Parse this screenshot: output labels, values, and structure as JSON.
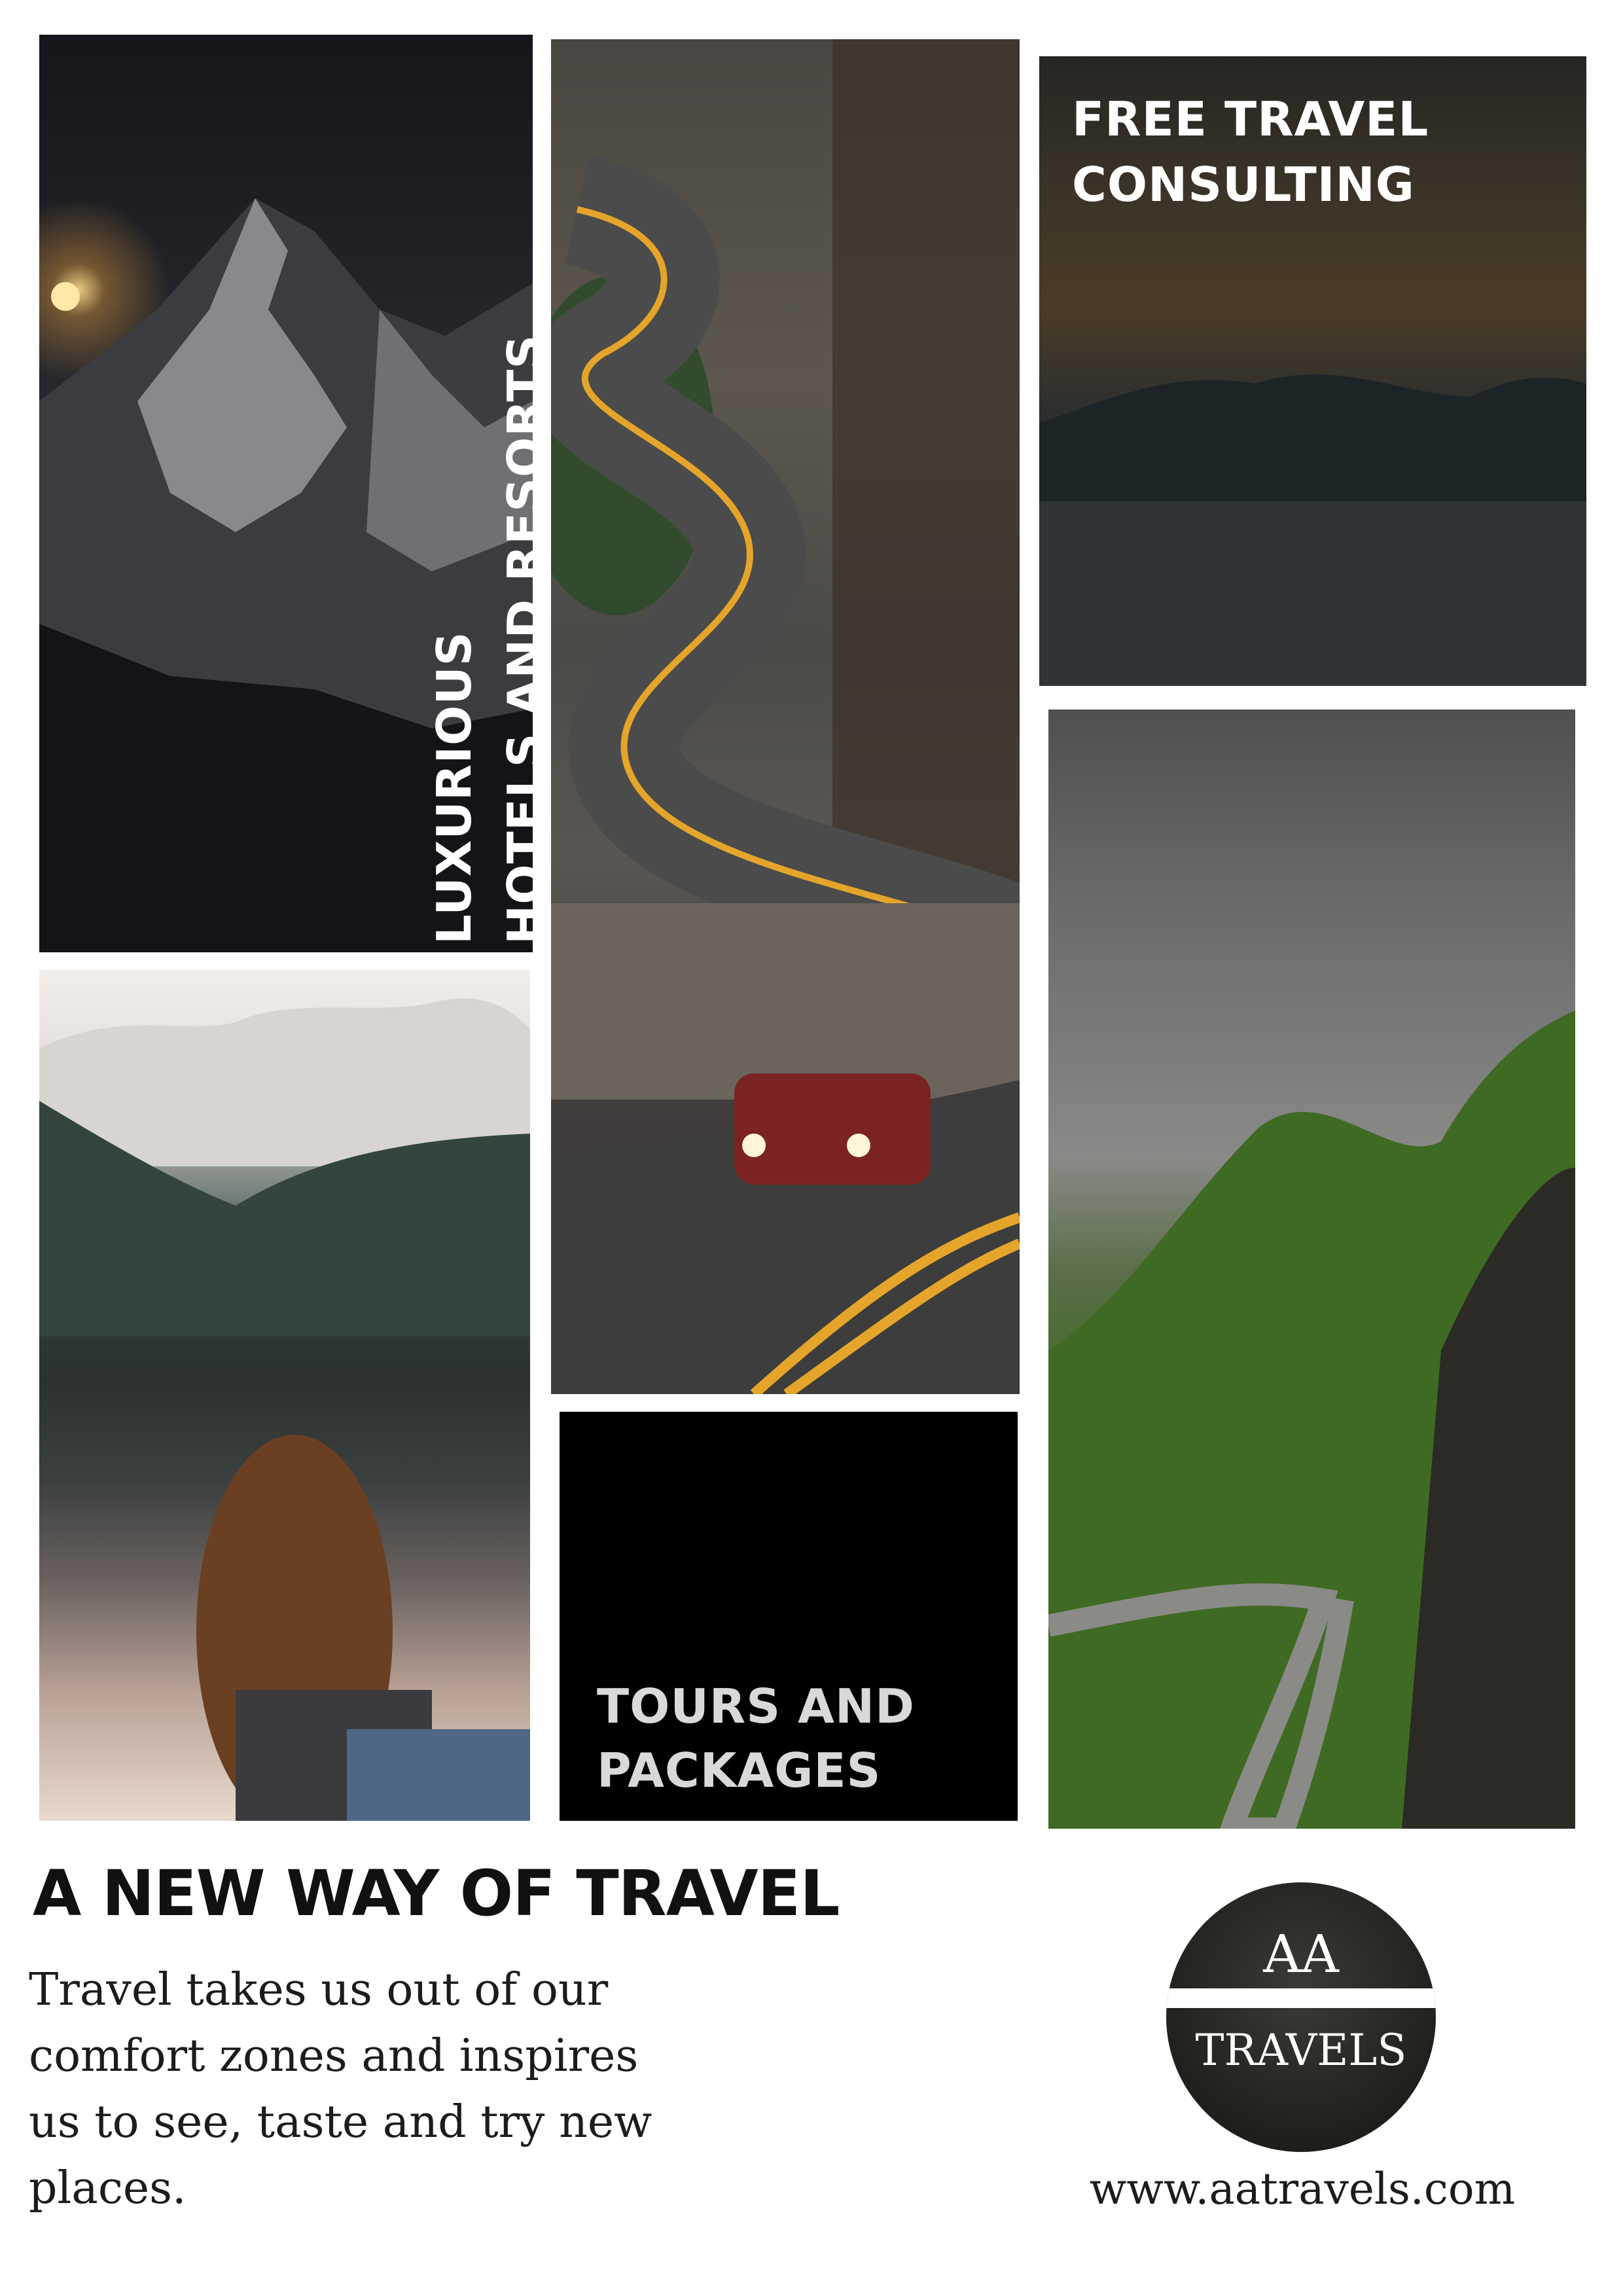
{
  "panels": {
    "hotels": {
      "line1": "LUXURIOUS",
      "line2": "HOTELS AND RESORTS"
    },
    "consulting": {
      "line1": "FREE TRAVEL",
      "line2": "CONSULTING"
    },
    "tours": {
      "line1": "TOURS AND",
      "line2": "PACKAGES"
    }
  },
  "headline": "A NEW WAY OF TRAVEL",
  "body": "Travel takes us out of our comfort zones and inspires us to see, taste and try new places.",
  "logo": {
    "top": "AA",
    "bottom": "TRAVELS"
  },
  "website": "www.aatravels.com"
}
